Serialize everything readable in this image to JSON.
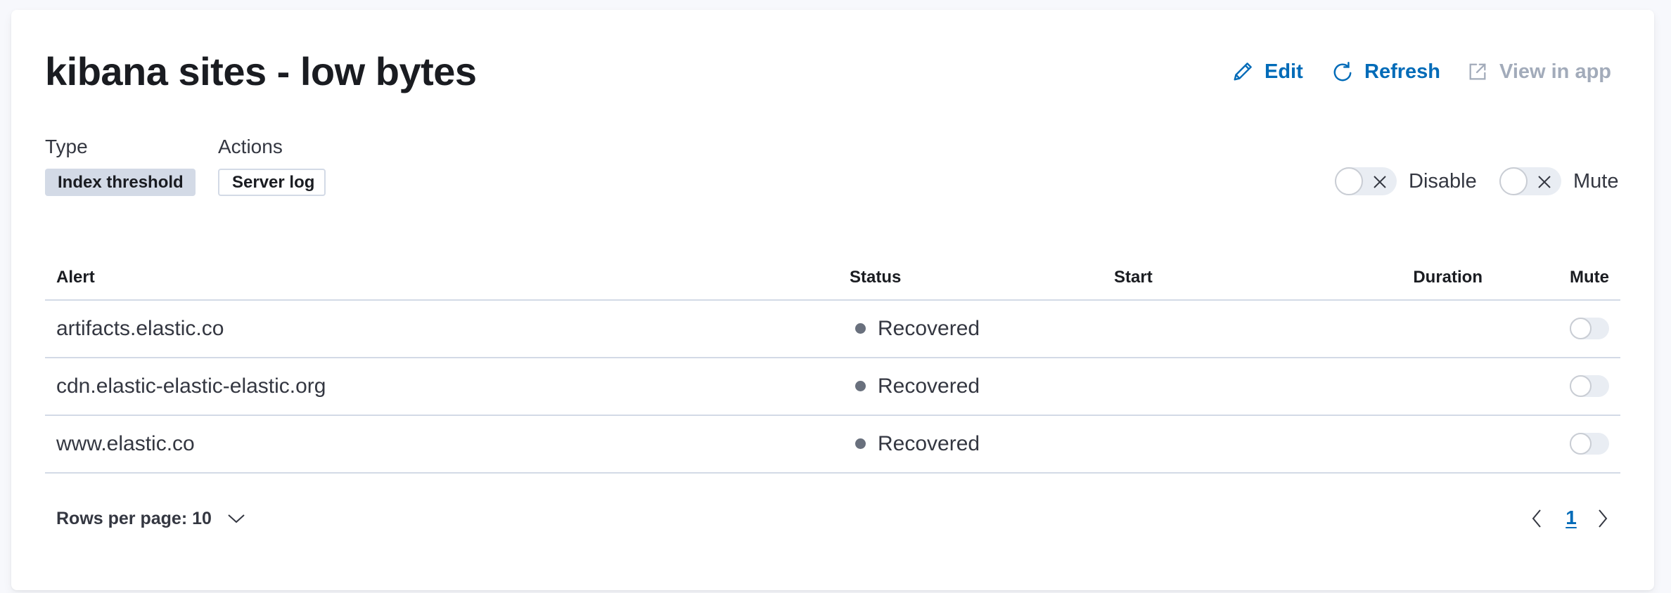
{
  "header": {
    "title": "kibana sites - low bytes",
    "actions": {
      "edit": {
        "label": "Edit",
        "icon": "pencil-icon"
      },
      "refresh": {
        "label": "Refresh",
        "icon": "refresh-icon"
      },
      "view_in_app": {
        "label": "View in app",
        "icon": "external-link-icon",
        "disabled": true
      }
    }
  },
  "meta": {
    "type_label": "Type",
    "type_value": "Index threshold",
    "actions_label": "Actions",
    "actions_value": "Server log"
  },
  "toggles": {
    "disable": {
      "label": "Disable",
      "checked": false
    },
    "mute": {
      "label": "Mute",
      "checked": false
    }
  },
  "table": {
    "columns": [
      "Alert",
      "Status",
      "Start",
      "Duration",
      "Mute"
    ],
    "rows": [
      {
        "alert": "artifacts.elastic.co",
        "status": "Recovered",
        "start": "",
        "duration": "",
        "muted": false
      },
      {
        "alert": "cdn.elastic-elastic-elastic.org",
        "status": "Recovered",
        "start": "",
        "duration": "",
        "muted": false
      },
      {
        "alert": "www.elastic.co",
        "status": "Recovered",
        "start": "",
        "duration": "",
        "muted": false
      }
    ]
  },
  "pagination": {
    "rows_per_page_label": "Rows per page: 10",
    "current_page": "1"
  },
  "colors": {
    "accent": "#006bb8",
    "disabled_link": "#a2abba",
    "status_recovered": "#69707d",
    "border": "#d3dae6"
  }
}
